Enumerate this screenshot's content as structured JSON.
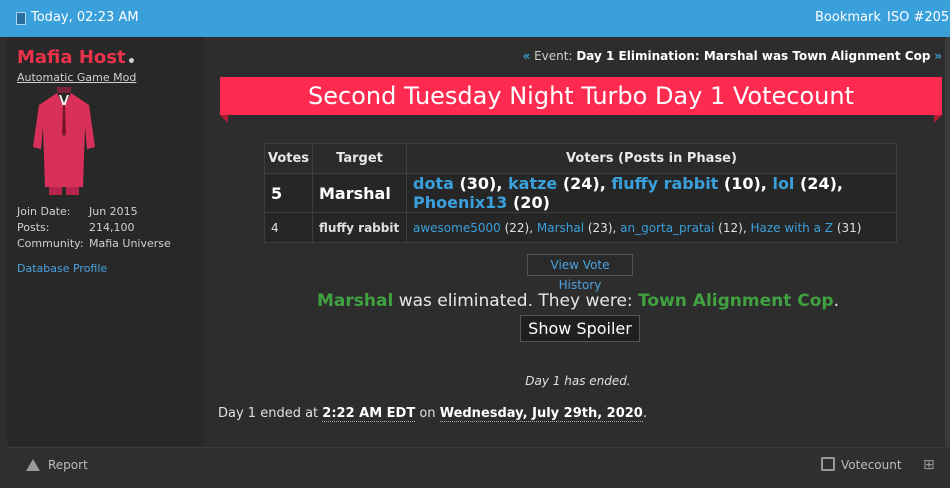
{
  "topbar": {
    "date": "Today, 02:23 AM",
    "bookmark": "Bookmark",
    "iso": "ISO #205"
  },
  "user": {
    "name": "Mafia Host",
    "title": "Automatic Game Mod",
    "stats": [
      {
        "label": "Join Date:",
        "value": "Jun 2015"
      },
      {
        "label": "Posts:",
        "value": "214,100"
      },
      {
        "label": "Community:",
        "value": "Mafia Universe"
      }
    ],
    "db_profile": "Database Profile"
  },
  "event": {
    "prefix": "Event:",
    "text": "Day 1 Elimination: Marshal was Town Alignment Cop"
  },
  "banner": "Second Tuesday Night Turbo Day 1 Votecount",
  "table": {
    "headers": [
      "Votes",
      "Target",
      "Voters (Posts in Phase)"
    ],
    "rows": [
      {
        "votes": "5",
        "target": "Marshal",
        "voters": [
          {
            "name": "dota",
            "posts": " (30)"
          },
          {
            "name": "katze",
            "posts": " (24)"
          },
          {
            "name": "fluffy rabbit",
            "posts": " (10)"
          },
          {
            "name": "lol",
            "posts": " (24)"
          },
          {
            "name": "Phoenix13",
            "posts": " (20)"
          }
        ]
      },
      {
        "votes": "4",
        "target": "fluffy rabbit",
        "voters": [
          {
            "name": "awesome5000",
            "posts": " (22)"
          },
          {
            "name": "Marshal",
            "posts": " (23)"
          },
          {
            "name": "an_gorta_pratai",
            "posts": " (12)"
          },
          {
            "name": "Haze with a Z",
            "posts": " (31)"
          }
        ]
      }
    ]
  },
  "history_button": "View Vote History",
  "elimination": {
    "player": "Marshal",
    "middle": " was eliminated. They were: ",
    "role": "Town Alignment Cop",
    "end": "."
  },
  "spoiler_button": "Show Spoiler",
  "day_ended": "Day 1 has ended.",
  "end_line": {
    "prefix": "Day 1 ended at ",
    "time": "2:22 AM EDT",
    "middle": " on ",
    "date": "Wednesday, July 29th, 2020",
    "end": "."
  },
  "footer": {
    "report": "Report",
    "votecount": "Votecount"
  },
  "colors": {
    "topbar": "#3aa0db",
    "banner": "#ff2a4f",
    "username": "#e8334a",
    "link": "#3aa0db",
    "highlight": "#3fa13f"
  }
}
